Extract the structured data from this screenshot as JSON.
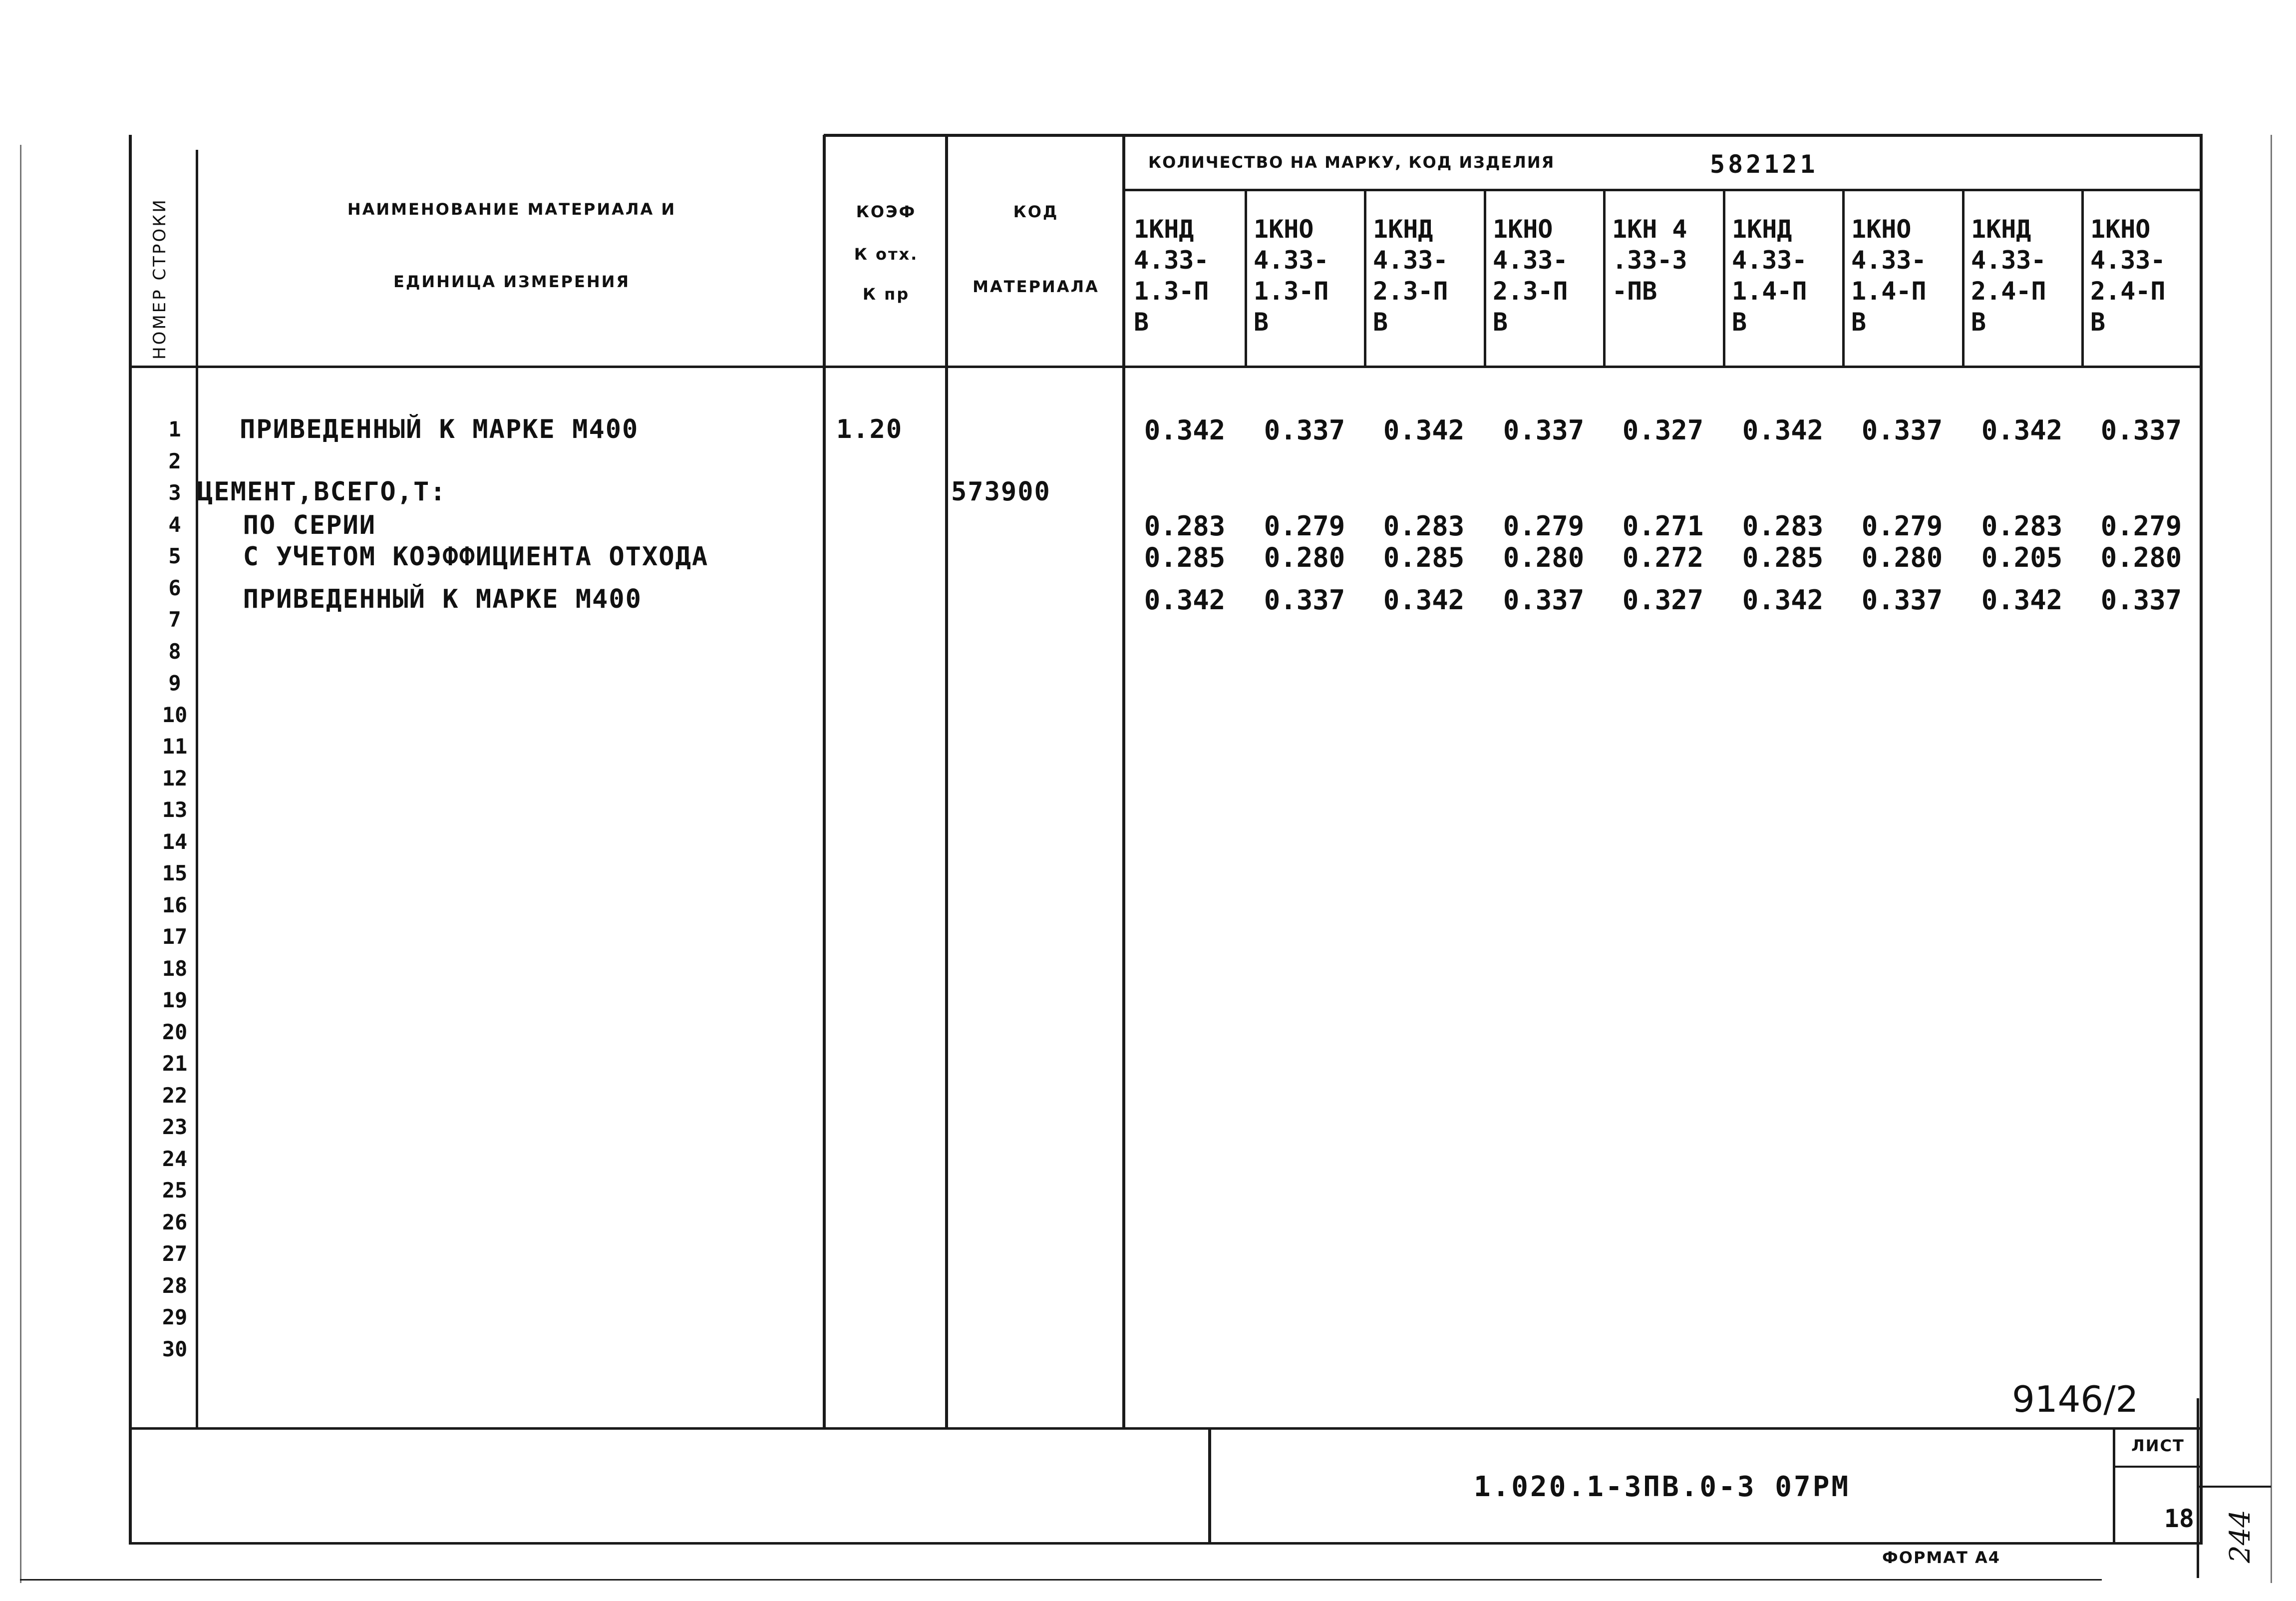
{
  "document": {
    "headers": {
      "row_number": "НОМЕР СТРОКИ",
      "material_name_line1": "НАИМЕНОВАНИЕ МАТЕРИАЛА И",
      "material_name_line2": "ЕДИНИЦА ИЗМЕРЕНИЯ",
      "coef_line1": "КОЭФ",
      "coef_line2": "К отх.",
      "coef_line3": "К пр",
      "code_line1": "КОД",
      "code_line2": "МАТЕРИАЛА",
      "quantity_group": "КОЛИЧЕСТВО НА МАРКУ, КОД ИЗДЕЛИЯ",
      "product_code": "582121"
    },
    "product_columns": [
      {
        "label": "1КНД\n4.33-\n1.3-П\nВ"
      },
      {
        "label": "1КНО\n4.33-\n1.3-П\nВ"
      },
      {
        "label": "1КНД\n4.33-\n2.3-П\nВ"
      },
      {
        "label": "1КНО\n4.33-\n2.3-П\nВ"
      },
      {
        "label": "1КН 4\n.33-3\n-ПВ"
      },
      {
        "label": "1КНД\n4.33-\n1.4-П\nВ"
      },
      {
        "label": "1КНО\n4.33-\n1.4-П\nВ"
      },
      {
        "label": "1КНД\n4.33-\n2.4-П\nВ"
      },
      {
        "label": "1КНО\n4.33-\n2.4-П\nВ"
      }
    ],
    "row_numbers": [
      "1",
      "2",
      "3",
      "4",
      "5",
      "6",
      "7",
      "8",
      "9",
      "10",
      "11",
      "12",
      "13",
      "14",
      "15",
      "16",
      "17",
      "18",
      "19",
      "20",
      "21",
      "22",
      "23",
      "24",
      "25",
      "26",
      "27",
      "28",
      "29",
      "30"
    ],
    "rows": [
      {
        "line": 1,
        "name": "ПРИВЕДЕННЫЙ К МАРКЕ М400",
        "coef": "1.20",
        "code": "",
        "values": [
          "0.342",
          "0.337",
          "0.342",
          "0.337",
          "0.327",
          "0.342",
          "0.337",
          "0.342",
          "0.337"
        ]
      },
      {
        "line": 3,
        "name": "ЦЕМЕНТ,ВСЕГО,Т:",
        "coef": "",
        "code": "573900",
        "values": []
      },
      {
        "line": 4,
        "name": "  ПО СЕРИИ",
        "coef": "",
        "code": "",
        "values": [
          "0.283",
          "0.279",
          "0.283",
          "0.279",
          "0.271",
          "0.283",
          "0.279",
          "0.283",
          "0.279"
        ]
      },
      {
        "line": 5,
        "name": "  С УЧЕТОМ КОЭФФИЦИЕНТА ОТХОДА",
        "coef": "",
        "code": "",
        "values": [
          "0.285",
          "0.280",
          "0.285",
          "0.280",
          "0.272",
          "0.285",
          "0.280",
          "0.205",
          "0.280"
        ]
      },
      {
        "line": 6,
        "name": "  ПРИВЕДЕННЫЙ К МАРКЕ М400",
        "coef": "",
        "code": "",
        "values": [
          "0.342",
          "0.337",
          "0.342",
          "0.337",
          "0.327",
          "0.342",
          "0.337",
          "0.342",
          "0.337"
        ]
      }
    ],
    "stamp_number": "9146/2",
    "title_block": {
      "designation": "1.020.1-3ПВ.0-3 07РМ",
      "sheet_label": "ЛИСТ",
      "sheet_number": "18"
    },
    "format_label": "ФОРМАТ А4",
    "handwritten_note": "244"
  }
}
